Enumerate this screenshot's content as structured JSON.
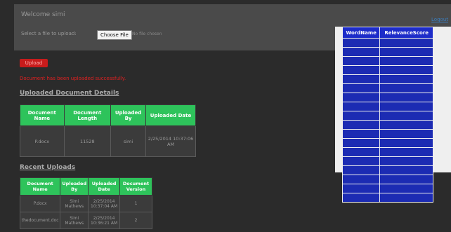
{
  "header": {
    "welcome": "Welcome simi",
    "upload_label": "Select a file to upload:",
    "choose_file": "Choose File",
    "no_file": "No file chosen",
    "logout": "Logout"
  },
  "upload": {
    "button_label": "Upload",
    "success_message": "Document has been uploaded successfully."
  },
  "details": {
    "title": "Uploaded Document Details",
    "headers": [
      "Document Name",
      "Document Length",
      "Uploaded By",
      "Uploaded Date"
    ],
    "row": [
      "P.docx",
      "11528",
      "simi",
      "2/25/2014 10:37:06 AM"
    ]
  },
  "recent": {
    "title": "Recent Uploads",
    "headers": [
      "Document Name",
      "Uploaded By",
      "Uploaded Date",
      "Document Version"
    ],
    "rows": [
      [
        "P.docx",
        "Simi Mathews",
        "2/25/2014 10:37:04 AM",
        "1"
      ],
      [
        "thedocument.doc",
        "Simi Mathews",
        "2/25/2014 10:36:21 AM",
        "2"
      ]
    ]
  },
  "words": {
    "headers": [
      "WordName",
      "RelevanceScore"
    ],
    "row_count": 18
  },
  "colors": {
    "table_header": "#2ec35b",
    "word_header": "#1d2cc9",
    "upload_button": "#c81c1c",
    "success_text": "#e02020",
    "link": "#3a7fc2"
  }
}
